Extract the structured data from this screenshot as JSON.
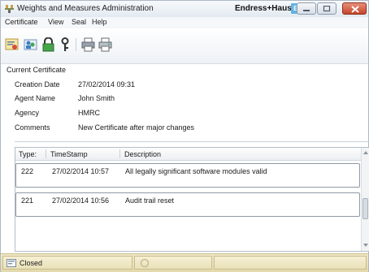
{
  "window": {
    "title": "Weights and Measures Administration",
    "brand": "Endress+Hauser",
    "brand_logo": "E+H",
    "minimize_icon": "minimize-icon",
    "maximize_icon": "maximize-icon",
    "close_icon": "close-icon"
  },
  "menu": {
    "items": [
      "Certificate",
      "View",
      "Seal",
      "Help"
    ]
  },
  "toolbar": {
    "icons": [
      "certificate-icon",
      "users-icon",
      "lock-icon",
      "key-icon",
      "seal-printer-icon",
      "printer-icon"
    ]
  },
  "certificate": {
    "header": "Current Certificate",
    "fields": [
      {
        "label": "Creation Date",
        "value": "27/02/2014 09:31"
      },
      {
        "label": "Agent Name",
        "value": "John Smith"
      },
      {
        "label": "Agency",
        "value": "HMRC"
      },
      {
        "label": "Comments",
        "value": "New Certificate after major changes"
      }
    ]
  },
  "audit": {
    "columns": [
      "Type:",
      "TimeStamp",
      "Description"
    ],
    "rows": [
      {
        "type": "222",
        "timestamp": "27/02/2014 10:57",
        "description": "All legally significant software modules valid"
      },
      {
        "type": "221",
        "timestamp": "27/02/2014 10:56",
        "description": "Audit trail reset"
      }
    ]
  },
  "status": {
    "state": "Closed",
    "state_icon": "seal-closed-icon"
  },
  "colors": {
    "statusbar": "#e3d9ad",
    "brand_logo": "#62b3e4",
    "close_button": "#c4452a"
  }
}
